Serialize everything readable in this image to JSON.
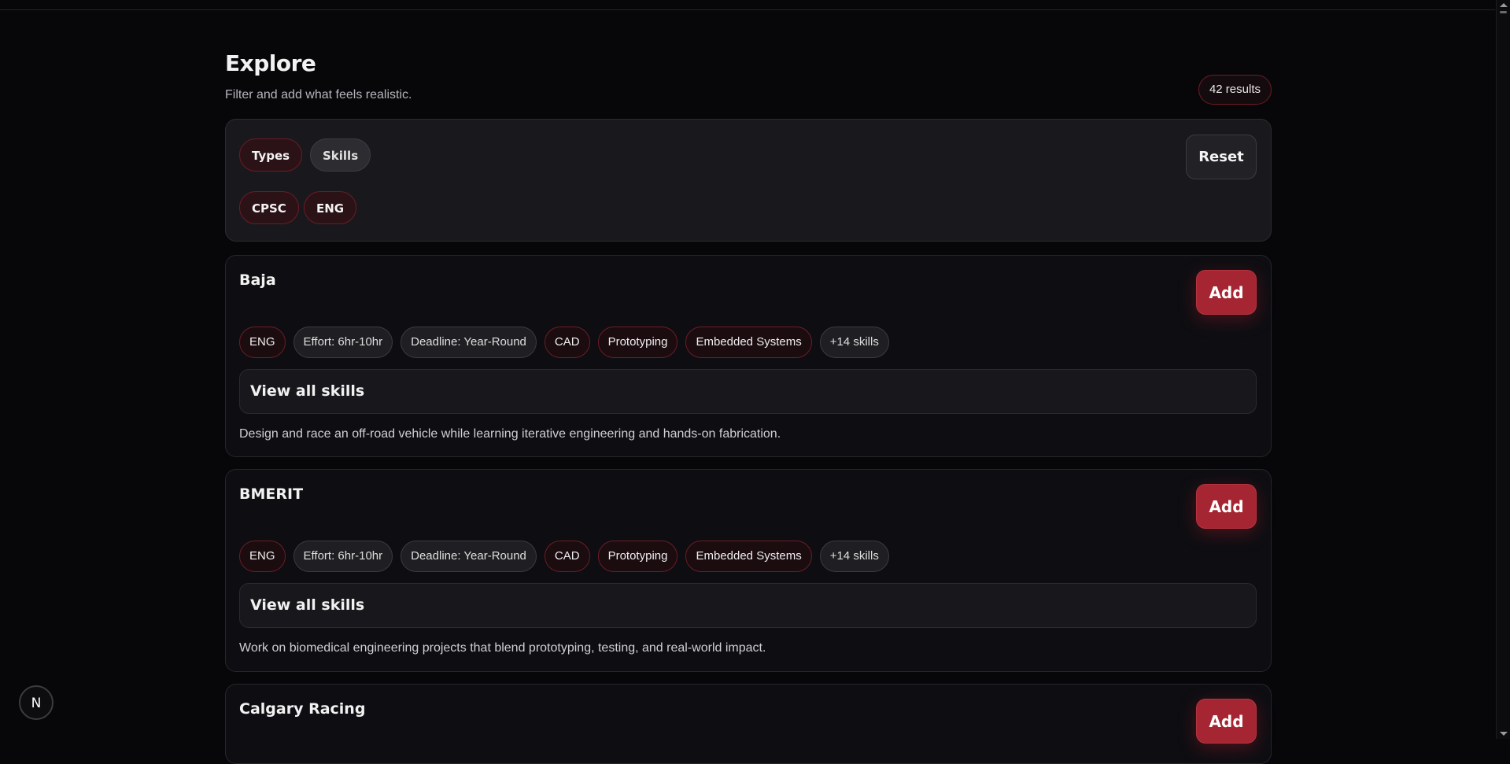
{
  "header": {
    "title": "Explore",
    "subtitle": "Filter and add what feels realistic.",
    "results": "42 results"
  },
  "filters": {
    "tabs": [
      {
        "label": "Types",
        "active": true
      },
      {
        "label": "Skills",
        "active": false
      }
    ],
    "selected": [
      "CPSC",
      "ENG"
    ],
    "reset_label": "Reset"
  },
  "cards": [
    {
      "title": "Baja",
      "add_label": "Add",
      "tags": [
        "ENG",
        "Effort: 6hr-10hr",
        "Deadline: Year-Round",
        "CAD",
        "Prototyping",
        "Embedded Systems",
        "+14 skills"
      ],
      "view_all_label": "View all skills",
      "description": "Design and race an off-road vehicle while learning iterative engineering and hands-on fabrication."
    },
    {
      "title": "BMERIT",
      "add_label": "Add",
      "tags": [
        "ENG",
        "Effort: 6hr-10hr",
        "Deadline: Year-Round",
        "CAD",
        "Prototyping",
        "Embedded Systems",
        "+14 skills"
      ],
      "view_all_label": "View all skills",
      "description": "Work on biomedical engineering projects that blend prototyping, testing, and real-world impact."
    },
    {
      "title": "Calgary Racing",
      "add_label": "Add"
    }
  ],
  "dev_badge": {
    "letter": "N"
  },
  "colors": {
    "accent": "#a52632",
    "background": "#07070a",
    "panel": "#19191d"
  }
}
